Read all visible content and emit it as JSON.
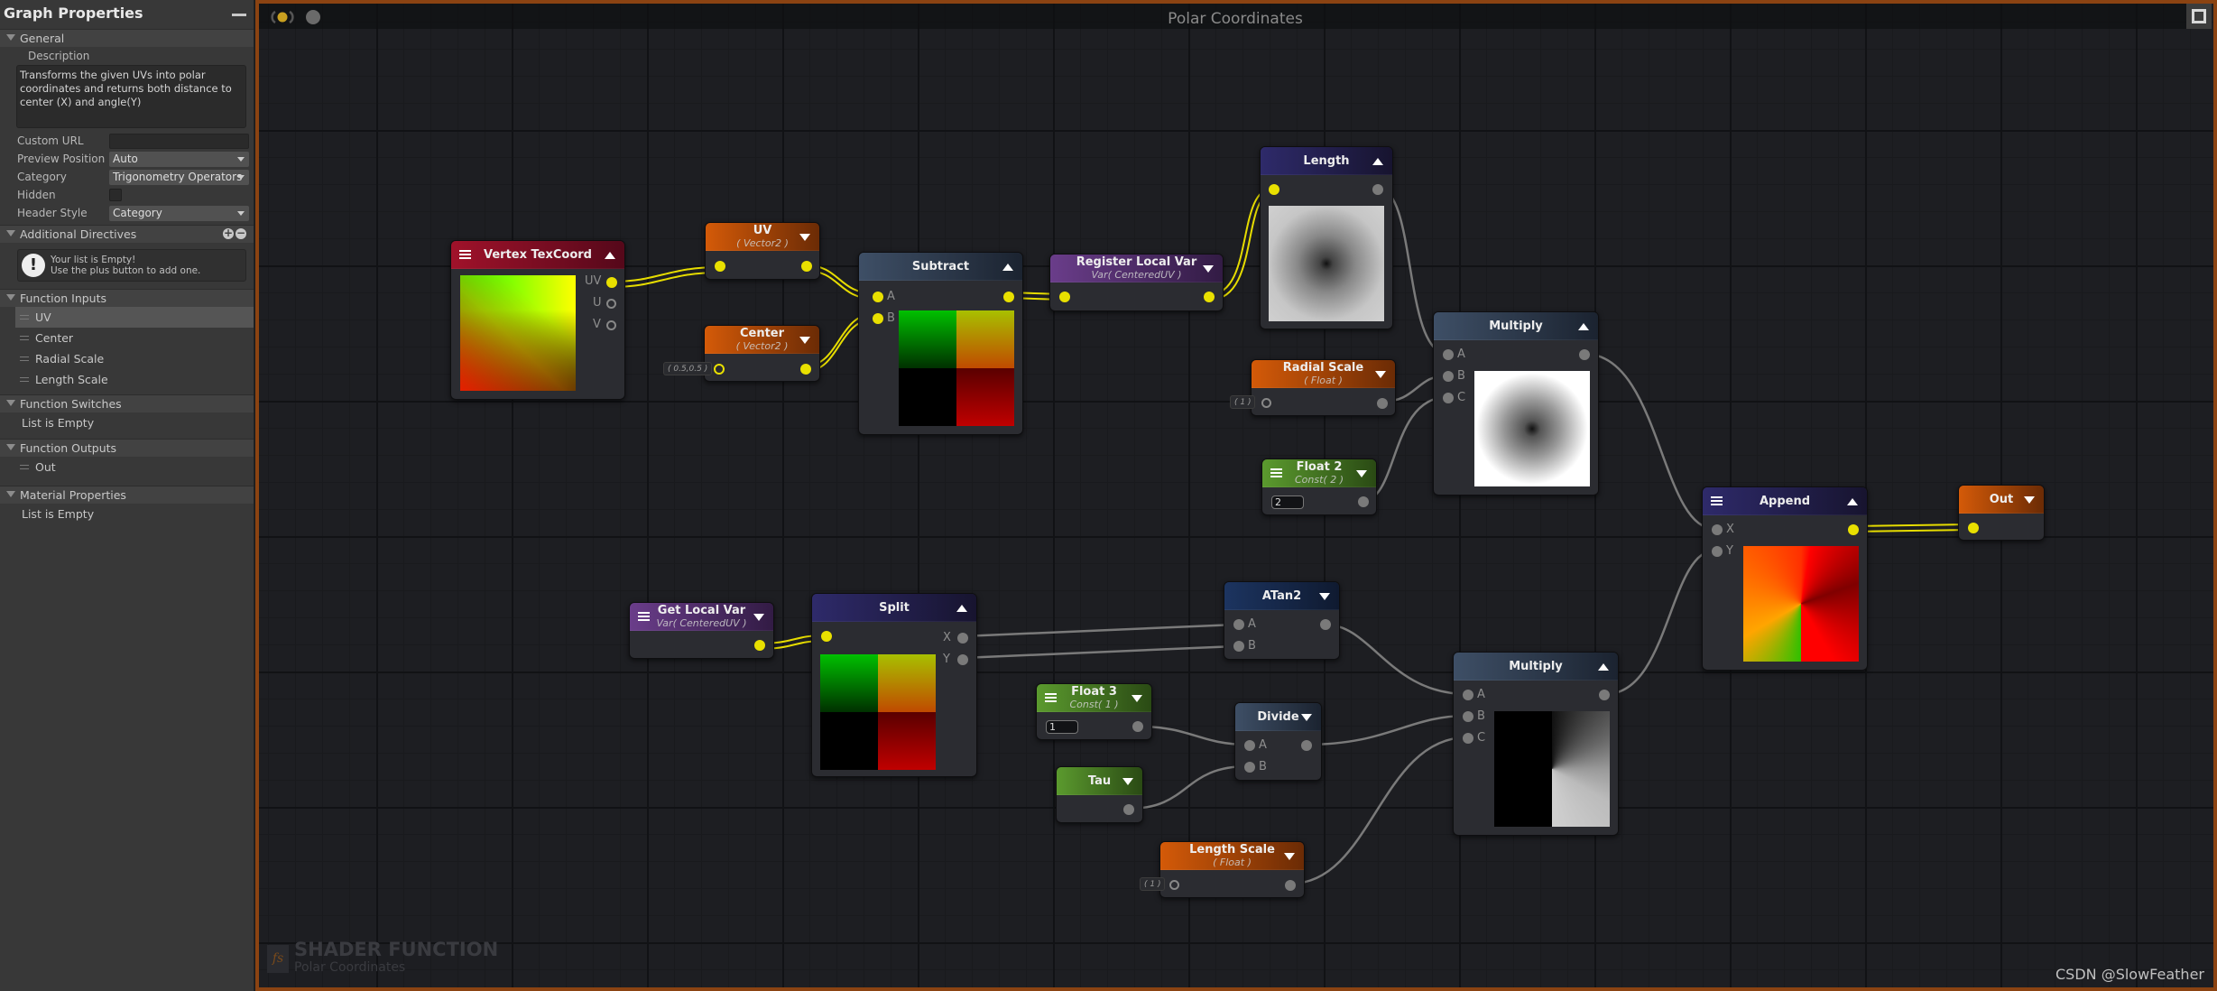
{
  "panel": {
    "title": "Graph Properties",
    "general": {
      "header": "General",
      "description_label": "Description",
      "description": "Transforms the given UVs into polar coordinates and returns both distance to center (X) and angle(Y)",
      "custom_url_label": "Custom URL",
      "custom_url": "",
      "preview_position_label": "Preview Position",
      "preview_position": "Auto",
      "category_label": "Category",
      "category": "Trigonometry Operators",
      "hidden_label": "Hidden",
      "hidden": false,
      "header_style_label": "Header Style",
      "header_style": "Category"
    },
    "additional_directives": {
      "header": "Additional Directives",
      "empty_line1": "Your list is Empty!",
      "empty_line2": "Use the plus button to add one."
    },
    "function_inputs": {
      "header": "Function Inputs",
      "items": [
        "UV",
        "Center",
        "Radial Scale",
        "Length Scale"
      ],
      "selected": "UV"
    },
    "function_switches": {
      "header": "Function Switches",
      "empty": "List is Empty"
    },
    "function_outputs": {
      "header": "Function Outputs",
      "items": [
        "Out"
      ]
    },
    "material_properties": {
      "header": "Material Properties",
      "empty": "List is Empty"
    }
  },
  "canvas": {
    "title": "Polar Coordinates",
    "watermark_type": "SHADER FUNCTION",
    "watermark_name": "Polar Coordinates",
    "credit": "CSDN @SlowFeather",
    "toolbar_icons": [
      "live-mode-icon",
      "clean-icon",
      "share-icon",
      "screenshot-icon",
      "focus-icon",
      "cleanup-icon",
      "info-icon",
      "maximize-icon"
    ],
    "accent_color": "#8b4312"
  },
  "nodes": {
    "vertex_texcoord": {
      "title": "Vertex TexCoord",
      "ports_out": [
        "UV",
        "U",
        "V"
      ]
    },
    "uv": {
      "title": "UV",
      "subtitle": "( Vector2 )"
    },
    "center": {
      "title": "Center",
      "subtitle": "( Vector2 )",
      "default": "( 0.5,0.5 )"
    },
    "subtract": {
      "title": "Subtract",
      "ports_in": [
        "A",
        "B"
      ]
    },
    "register_local_var": {
      "title": "Register Local Var",
      "subtitle": "Var( CenteredUV )"
    },
    "length": {
      "title": "Length"
    },
    "radial_scale": {
      "title": "Radial Scale",
      "subtitle": "( Float )",
      "default": "( 1 )"
    },
    "float2": {
      "title": "Float 2",
      "subtitle": "Const( 2 )",
      "value": "2"
    },
    "multiply1": {
      "title": "Multiply",
      "ports_in": [
        "A",
        "B",
        "C"
      ]
    },
    "append": {
      "title": "Append",
      "ports_in": [
        "X",
        "Y"
      ]
    },
    "out": {
      "title": "Out"
    },
    "get_local_var": {
      "title": "Get Local Var",
      "subtitle": "Var( CenteredUV )"
    },
    "split": {
      "title": "Split",
      "ports_out": [
        "X",
        "Y"
      ]
    },
    "atan2": {
      "title": "ATan2",
      "ports_in": [
        "A",
        "B"
      ]
    },
    "float3": {
      "title": "Float 3",
      "subtitle": "Const( 1 )",
      "value": "1"
    },
    "tau": {
      "title": "Tau"
    },
    "divide": {
      "title": "Divide",
      "ports_in": [
        "A",
        "B"
      ]
    },
    "length_scale": {
      "title": "Length Scale",
      "subtitle": "( Float )",
      "default": "( 1 )"
    },
    "multiply2": {
      "title": "Multiply",
      "ports_in": [
        "A",
        "B",
        "C"
      ]
    }
  }
}
